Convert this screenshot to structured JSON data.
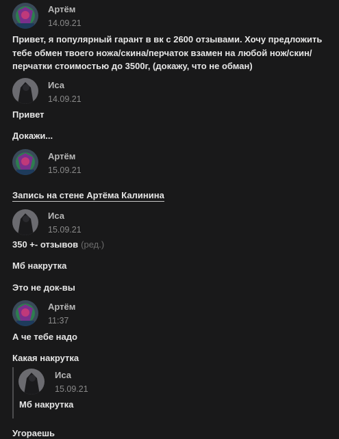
{
  "messages": [
    {
      "author": "Артём",
      "date": "14.09.21",
      "lines": [
        "Привет, я популярный гарант в вк с 2600 отзывами. Хочу предложить тебе обмен твоего ножа/скина/перчаток взамен на любой нож/скин/перчатки стоимостью до 3500г, (докажу, что не обман)"
      ]
    },
    {
      "author": "Иса",
      "date": "14.09.21",
      "lines": [
        "Привет",
        "Докажи..."
      ]
    },
    {
      "author": "Артём",
      "date": "15.09.21",
      "wall_link": "Запись на стене Артёма Калинина"
    },
    {
      "author": "Иса",
      "date": "15.09.21",
      "lines": [
        "350 +- отзывов",
        "Мб накрутка",
        "Это не док-вы"
      ],
      "edited_label": "(ред.)"
    },
    {
      "author": "Артём",
      "date": "11:37",
      "lines": [
        "А че тебе надо",
        "Какая накрутка"
      ],
      "quote": {
        "author": "Иса",
        "date": "15.09.21",
        "text": "Мб накрутка"
      },
      "after_quote": "Угораешь"
    }
  ],
  "colors": {
    "background": "#19191a",
    "text": "#e6e6e6",
    "author": "#b8b8b8",
    "meta": "#8a8a8a"
  }
}
